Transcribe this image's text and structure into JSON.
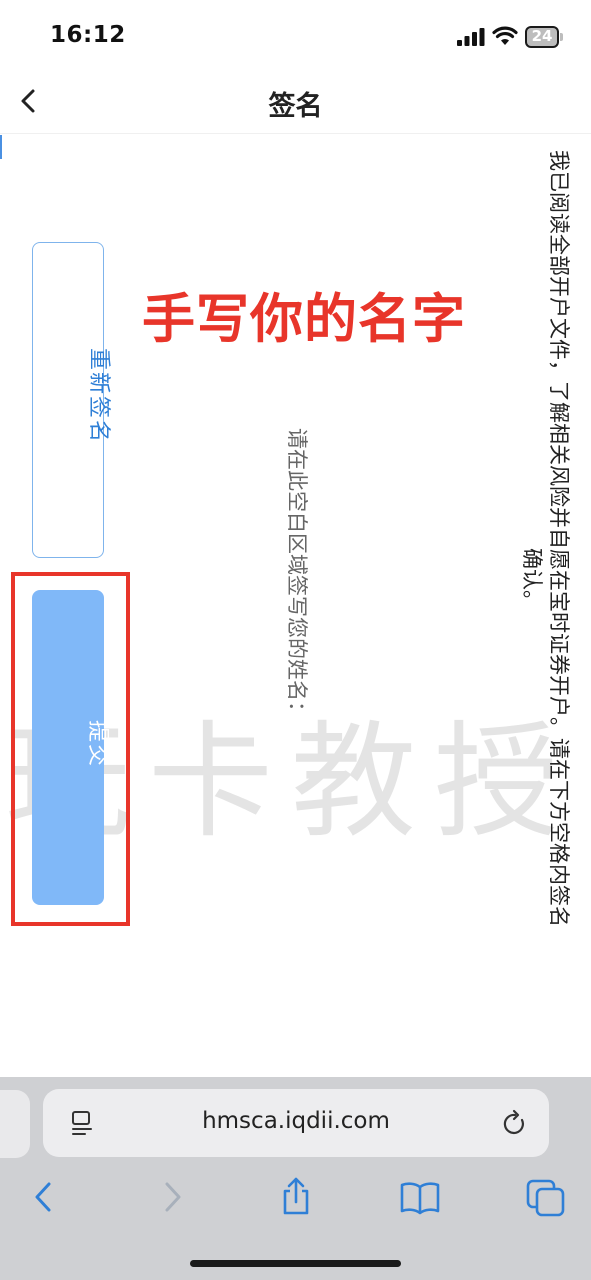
{
  "status_bar": {
    "time": "16:12",
    "battery": "24"
  },
  "nav": {
    "title": "签名",
    "back_icon": "chevron-left-icon"
  },
  "content": {
    "disclaimer_line1": "我已阅读全部开户文件，了解相关风险并自愿在宝时证券开户。请在下方空格内签名",
    "disclaimer_line2": "确认。",
    "signature_hint": "请在此空白区域签写您的姓名：",
    "overlay_caption": "手写你的名字",
    "watermark": "玩卡教授",
    "resign_label": "重新签名",
    "submit_label": "提交"
  },
  "browser": {
    "url": "hmsca.iqdii.com",
    "toolbar_icons": [
      "back-icon",
      "forward-icon",
      "share-icon",
      "bookmarks-icon",
      "tabs-icon"
    ]
  },
  "colors": {
    "accent_blue": "#2f7fd6",
    "button_blue": "#80b8f8",
    "highlight_red": "#e8352a"
  }
}
